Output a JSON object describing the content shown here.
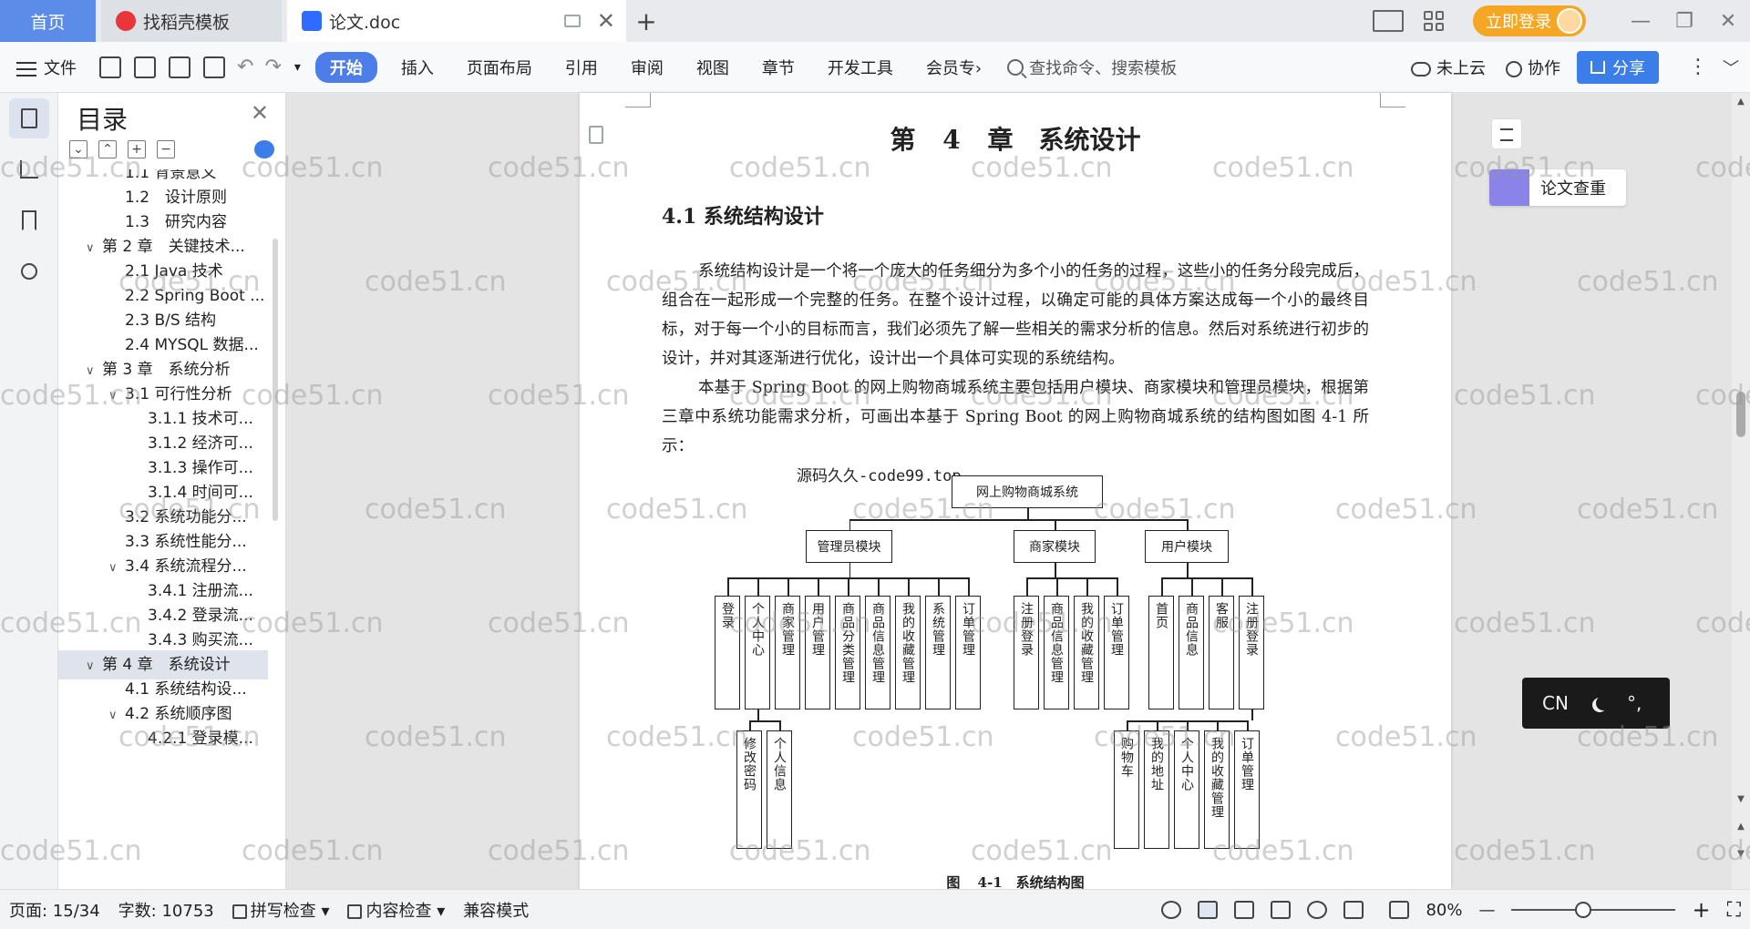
{
  "tabs": {
    "home": "首页",
    "template": "找稻壳模板",
    "document": "论文.doc",
    "close": "✕",
    "new_tab": "+"
  },
  "titlebar": {
    "login": "立即登录",
    "minimize": "—",
    "restore": "❐",
    "close": "✕"
  },
  "toolbar": {
    "file": "文件",
    "undo": "↶",
    "redo": "↷",
    "dropdown": "▾",
    "start": "开始",
    "insert": "插入",
    "layout": "页面布局",
    "reference": "引用",
    "review": "审阅",
    "view": "视图",
    "chapter": "章节",
    "devtools": "开发工具",
    "member": "会员专",
    "member_chevron": "›",
    "search_placeholder": "查找命令、搜索模板",
    "cloud": "未上云",
    "collab": "协作",
    "share": "分享",
    "more": "⋮",
    "collapse": "﹀"
  },
  "toc": {
    "title": "目录",
    "close": "✕",
    "ctrl_collapse": "⌄",
    "ctrl_expand": "⌃",
    "ctrl_add": "+",
    "ctrl_remove": "−",
    "items": [
      {
        "level": 2,
        "text": "1.1 背景意义",
        "arrow": ""
      },
      {
        "level": 2,
        "text": "1.2　设计原则",
        "arrow": ""
      },
      {
        "level": 2,
        "text": "1.3　研究内容",
        "arrow": ""
      },
      {
        "level": 1,
        "text": "第 2 章　关键技术...",
        "arrow": "∨"
      },
      {
        "level": 2,
        "text": "2.1 Java 技术",
        "arrow": ""
      },
      {
        "level": 2,
        "text": "2.2 Spring Boot ...",
        "arrow": ""
      },
      {
        "level": 2,
        "text": "2.3 B/S 结构",
        "arrow": ""
      },
      {
        "level": 2,
        "text": "2.4 MYSQL 数据...",
        "arrow": ""
      },
      {
        "level": 1,
        "text": "第 3 章　系统分析",
        "arrow": "∨"
      },
      {
        "level": 2,
        "text": "3.1 可行性分析",
        "arrow": "∨"
      },
      {
        "level": 3,
        "text": "3.1.1 技术可...",
        "arrow": ""
      },
      {
        "level": 3,
        "text": "3.1.2 经济可...",
        "arrow": ""
      },
      {
        "level": 3,
        "text": "3.1.3 操作可...",
        "arrow": ""
      },
      {
        "level": 3,
        "text": "3.1.4 时间可...",
        "arrow": ""
      },
      {
        "level": 2,
        "text": "3.2 系统功能分...",
        "arrow": ""
      },
      {
        "level": 2,
        "text": "3.3 系统性能分...",
        "arrow": ""
      },
      {
        "level": 2,
        "text": "3.4 系统流程分...",
        "arrow": "∨"
      },
      {
        "level": 3,
        "text": "3.4.1 注册流...",
        "arrow": ""
      },
      {
        "level": 3,
        "text": "3.4.2 登录流...",
        "arrow": ""
      },
      {
        "level": 3,
        "text": "3.4.3 购买流...",
        "arrow": ""
      },
      {
        "level": 1,
        "text": "第 4 章　系统设计",
        "arrow": "∨",
        "selected": true
      },
      {
        "level": 2,
        "text": "4.1 系统结构设...",
        "arrow": ""
      },
      {
        "level": 2,
        "text": "4.2 系统顺序图",
        "arrow": "∨"
      },
      {
        "level": 3,
        "text": "4.2.1 登录模...",
        "arrow": ""
      }
    ]
  },
  "document": {
    "chapter_title": "第 4 章　系统设计",
    "section_title": "4.1  系统结构设计",
    "para1": "系统结构设计是一个将一个庞大的任务细分为多个小的任务的过程，这些小的任务分段完成后，组合在一起形成一个完整的任务。在整个设计过程，以确定可能的具体方案达成每一个小的最终目标，对于每一个小的目标而言，我们必须先了解一些相关的需求分析的信息。然后对系统进行初步的设计，并对其逐渐进行优化，设计出一个具体可实现的系统结构。",
    "para2": "本基于 Spring Boot 的网上购物商城系统主要包括用户模块、商家模块和管理员模块，根据第三章中系统功能需求分析，可画出本基于 Spring Boot 的网上购物商城系统的结构图如图 4-1 所示：",
    "source_watermark": "源码久久-code99.top",
    "figure_caption": "图 4-1　系统结构图",
    "diagram": {
      "root": "网上购物商城系统",
      "modules": [
        "管理员模块",
        "商家模块",
        "用户模块"
      ],
      "admin_children": [
        "登录",
        "个人中心",
        "商家管理",
        "用户管理",
        "商品分类管理",
        "商品信息管理",
        "我的收藏管理",
        "系统管理",
        "订单管理"
      ],
      "admin_sub": [
        "修改密码",
        "个人信息"
      ],
      "merchant_children": [
        "注册登录",
        "商品信息管理",
        "我的收藏管理",
        "订单管理"
      ],
      "user_children": [
        "首页",
        "商品信息",
        "客服",
        "注册登录"
      ],
      "user_sub": [
        "购物车",
        "我的地址",
        "个人中心",
        "我的收藏管理",
        "订单管理"
      ]
    }
  },
  "right_panel": {
    "plagiarism_check": "论文查重",
    "ime_lang": "CN",
    "ime_punct": "°,"
  },
  "status": {
    "page": "页面: 15/34",
    "words": "字数: 10753",
    "spell": "拼写检查",
    "content": "内容检查",
    "compat": "兼容模式",
    "zoom": "80%",
    "zoom_out": "—",
    "zoom_in": "+",
    "fullscreen": "⛶"
  },
  "watermark": "code51.cn",
  "colors": {
    "accent": "#3b7de9",
    "login": "#f5a623",
    "home_tab": "#5b8de8"
  }
}
